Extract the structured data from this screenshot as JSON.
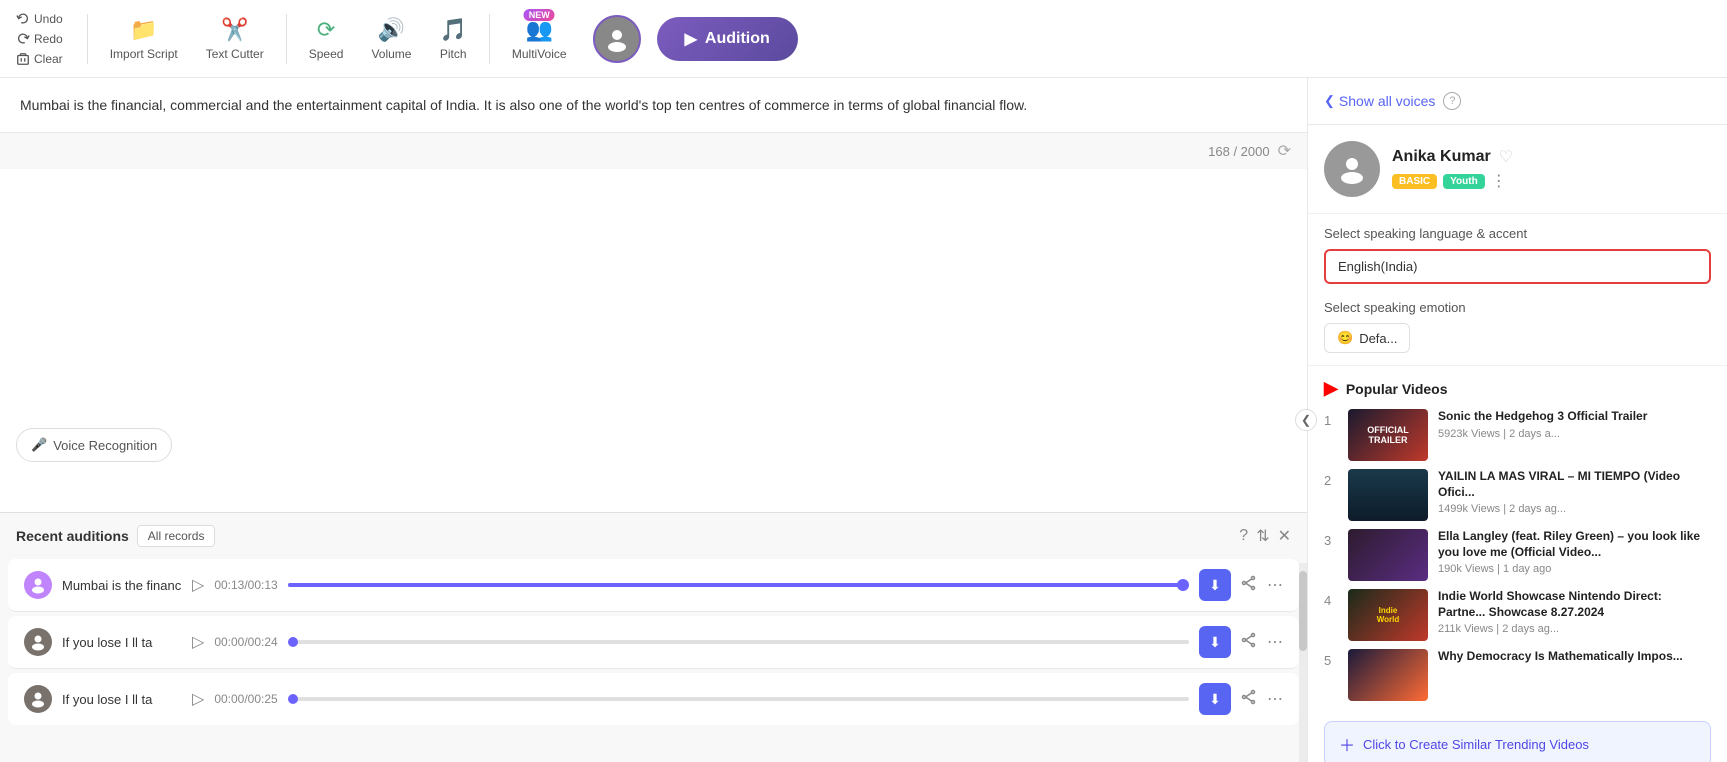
{
  "toolbar": {
    "undo_label": "Undo",
    "redo_label": "Redo",
    "clear_label": "Clear",
    "import_script_label": "Import Script",
    "text_cutter_label": "Text Cutter",
    "speed_label": "Speed",
    "volume_label": "Volume",
    "pitch_label": "Pitch",
    "multivoice_label": "MultiVoice",
    "new_badge": "NEW",
    "audition_label": "Audition"
  },
  "editor": {
    "content": "Mumbai is the financial, commercial and the entertainment capital of India. It is also one of the world's top ten centres of commerce in terms of global financial flow.",
    "char_count": "168",
    "char_limit": "2000",
    "voice_recognition_label": "Voice Recognition"
  },
  "bottom_panel": {
    "title": "Recent auditions",
    "all_records_label": "All records",
    "items": [
      {
        "name": "Mumbai is the financ",
        "time_current": "00:13",
        "time_total": "00:13",
        "progress": 100,
        "avatar_type": "female"
      },
      {
        "name": "If you lose I ll ta",
        "time_current": "00:00",
        "time_total": "00:24",
        "progress": 0,
        "avatar_type": "male"
      },
      {
        "name": "If you lose I ll ta",
        "time_current": "00:00",
        "time_total": "00:25",
        "progress": 0,
        "avatar_type": "male"
      }
    ]
  },
  "sidebar": {
    "show_all_voices": "Show all voices",
    "voice_name": "Anika Kumar",
    "tag_basic": "BASIC",
    "tag_youth": "Youth",
    "select_language_label": "Select speaking language & accent",
    "language_value": "English(India)",
    "select_emotion_label": "Select speaking emotion",
    "emotion_value": "Defa...",
    "popular_videos_title": "Popular Videos",
    "videos": [
      {
        "num": "1",
        "title": "Sonic the Hedgehog 3 Official Trailer",
        "stats": "5923k Views | 2 days a..."
      },
      {
        "num": "2",
        "title": "YAILIN LA MAS VIRAL – MI TIEMPO (Video Ofici...",
        "stats": "1499k Views | 2 days ag..."
      },
      {
        "num": "3",
        "title": "Ella Langley (feat. Riley Green) – you look like you love me (Official Video...",
        "stats": "190k Views | 1 day ago"
      },
      {
        "num": "4",
        "title": "Indie World Showcase Nintendo Direct: Partne... Showcase 8.27.2024",
        "stats": "211k Views | 2 days ag..."
      },
      {
        "num": "5",
        "title": "Why Democracy Is Mathematically Impos...",
        "stats": ""
      }
    ],
    "create_similar_label": "Click to Create Similar Trending Videos"
  }
}
